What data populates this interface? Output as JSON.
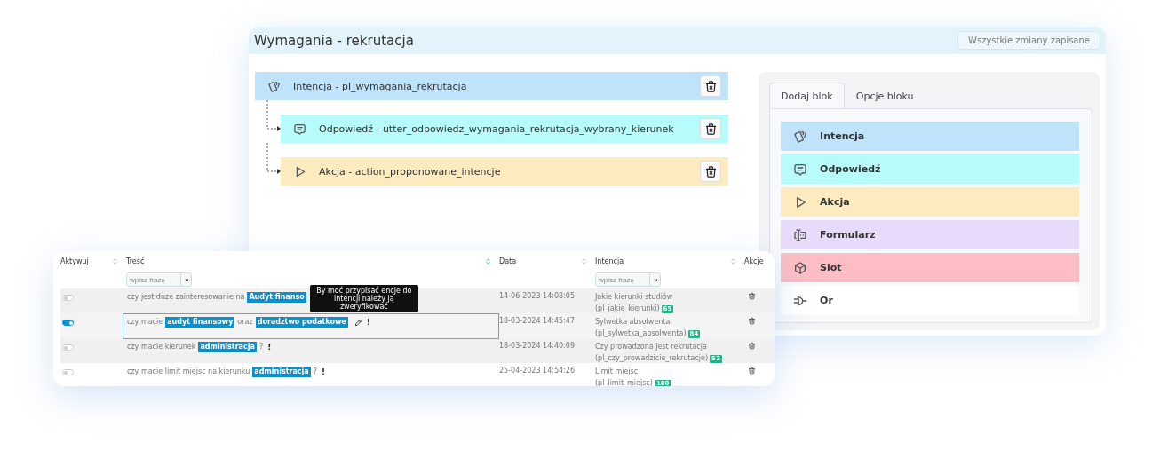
{
  "editor": {
    "title": "Wymagania - rekrutacja",
    "save_status": "Wszystkie zmiany zapisane",
    "tree": {
      "kind": "intencja",
      "label": "Intencja - pl_wymagania_rekrutacja",
      "children": [
        {
          "kind": "odpowiedz",
          "label": "Odpowiedź - utter_odpowiedz_wymagania_rekrutacja_wybrany_kierunek"
        },
        {
          "kind": "akcja",
          "label": "Akcja - action_proponowane_intencje"
        }
      ]
    },
    "tabs": [
      {
        "label": "Dodaj blok",
        "selected": true
      },
      {
        "label": "Opcje bloku",
        "selected": false
      }
    ],
    "palette": [
      {
        "kind": "intencja",
        "label": "Intencja"
      },
      {
        "kind": "odpowiedz",
        "label": "Odpowiedź"
      },
      {
        "kind": "akcja",
        "label": "Akcja"
      },
      {
        "kind": "formularz",
        "label": "Formularz"
      },
      {
        "kind": "slot",
        "label": "Slot"
      },
      {
        "kind": "or",
        "label": "Or"
      }
    ]
  },
  "table": {
    "columns": [
      {
        "label": "Aktywuj",
        "sorted": false
      },
      {
        "label": "Treść",
        "sorted": true,
        "filter": {
          "placeholder": "wpisz frazę",
          "clear": "×"
        }
      },
      {
        "label": "Data",
        "sorted": false
      },
      {
        "label": "Intencja",
        "sorted": false,
        "filter": {
          "placeholder": "wpisz frazę",
          "clear": "×"
        }
      },
      {
        "label": "Akcje"
      }
    ],
    "rows": [
      {
        "active": false,
        "selected": false,
        "parts": [
          {
            "kind": "text",
            "text": "czy jest duze zainteresowanie na"
          },
          {
            "kind": "tag",
            "text": "Audyt finanso"
          }
        ],
        "date": "14-06-2023 14:08:05",
        "intent_name": "Jakie kierunki studiów",
        "intent_id": "(pl_jakie_kierunki)",
        "count": "65",
        "tooltip": "By moć przypisać encje do intencji należy ją zweryfikować"
      },
      {
        "active": true,
        "selected": true,
        "parts": [
          {
            "kind": "text",
            "text": "czy macie"
          },
          {
            "kind": "tag",
            "text": "audyt finansowy"
          },
          {
            "kind": "text",
            "text": "oraz"
          },
          {
            "kind": "tag",
            "text": "doradztwo podatkowe"
          },
          {
            "kind": "edit"
          },
          {
            "kind": "warning",
            "text": "!"
          }
        ],
        "date": "18-03-2024 14:45:47",
        "intent_name": "Sylwetka absolwenta",
        "intent_id": "(pl_sylwetka_absolwenta)",
        "count": "84"
      },
      {
        "active": false,
        "selected": false,
        "parts": [
          {
            "kind": "text",
            "text": "czy macie kierunek"
          },
          {
            "kind": "tag",
            "text": "administracja"
          },
          {
            "kind": "text",
            "text": "?"
          },
          {
            "kind": "warning",
            "text": "!"
          }
        ],
        "date": "18-03-2024 14:40:09",
        "intent_name": "Czy prowadzona jest rekrutacja",
        "intent_id": "(pl_czy_prowadzicie_rekrutacje)",
        "count": "52"
      },
      {
        "active": false,
        "selected": false,
        "parts": [
          {
            "kind": "text",
            "text": "czy macie limit miejsc na kierunku"
          },
          {
            "kind": "tag",
            "text": "administracja"
          },
          {
            "kind": "text",
            "text": "?"
          },
          {
            "kind": "warning",
            "text": "!"
          }
        ],
        "date": "25-04-2023 14:54:26",
        "intent_name": "Limit miejsc",
        "intent_id": "(pl_limit_miejsc)",
        "count": "100"
      }
    ]
  }
}
